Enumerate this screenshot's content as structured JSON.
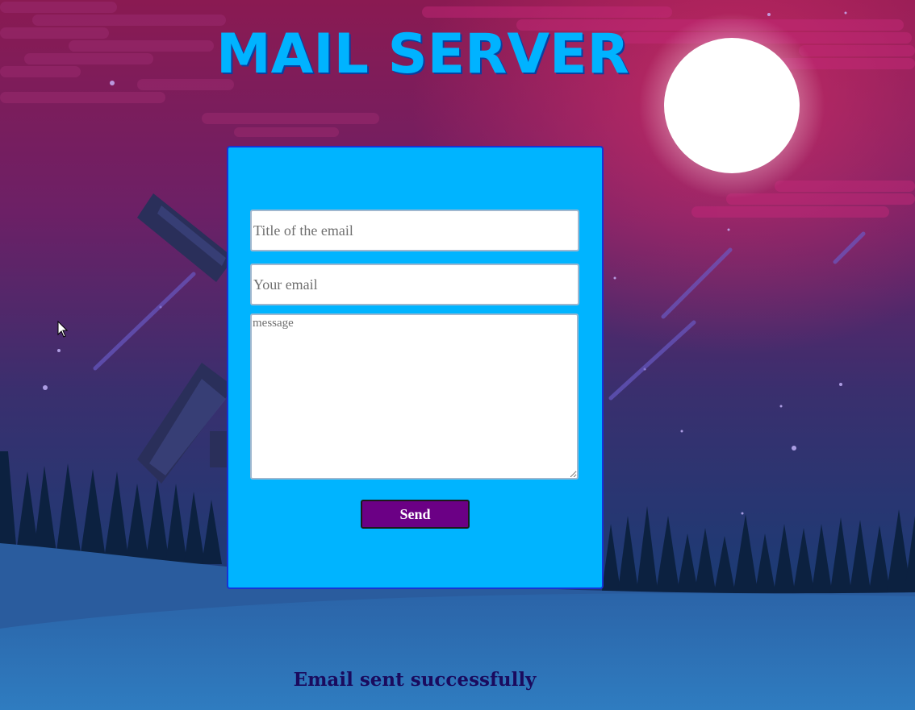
{
  "header": {
    "title": "MAIL SERVER"
  },
  "form": {
    "title_placeholder": "Title of the email",
    "email_placeholder": "Your email",
    "message_placeholder": "message",
    "send_label": "Send"
  },
  "status": {
    "message": "Email sent successfully"
  },
  "colors": {
    "title": "#00b3ff",
    "card": "#00b4ff",
    "button": "#6b0085",
    "status_text": "#1a0b5e"
  },
  "icons": {
    "cursor": "mouse-pointer-icon",
    "moon": "moon-decoration"
  }
}
